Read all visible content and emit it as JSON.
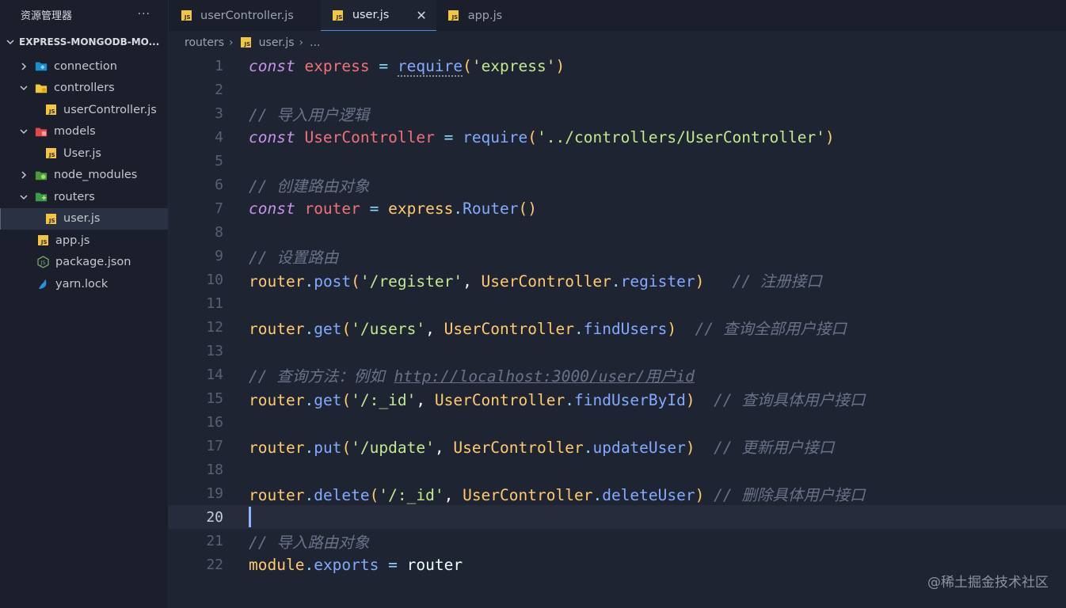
{
  "sidebar": {
    "title": "资源管理器",
    "more": "···",
    "project": "EXPRESS-MONGODB-MO...",
    "items": [
      {
        "label": "connection",
        "type": "folder",
        "expanded": false,
        "depth": 1
      },
      {
        "label": "controllers",
        "type": "folder",
        "expanded": true,
        "depth": 1
      },
      {
        "label": "userController.js",
        "type": "js",
        "depth": 2
      },
      {
        "label": "models",
        "type": "folder",
        "expanded": true,
        "depth": 1
      },
      {
        "label": "User.js",
        "type": "js",
        "depth": 2
      },
      {
        "label": "node_modules",
        "type": "folder",
        "expanded": false,
        "depth": 1
      },
      {
        "label": "routers",
        "type": "folder",
        "expanded": true,
        "depth": 1
      },
      {
        "label": "user.js",
        "type": "js",
        "depth": 2,
        "active": true
      },
      {
        "label": "app.js",
        "type": "js",
        "depth": 1
      },
      {
        "label": "package.json",
        "type": "json",
        "depth": 1
      },
      {
        "label": "yarn.lock",
        "type": "yarn",
        "depth": 1
      }
    ]
  },
  "tabs": [
    {
      "label": "userController.js",
      "active": false
    },
    {
      "label": "user.js",
      "active": true,
      "close": "✕"
    },
    {
      "label": "app.js",
      "active": false
    }
  ],
  "breadcrumb": {
    "folder": "routers",
    "file": "user.js",
    "more": "..."
  },
  "editor": {
    "current_line": 20,
    "lines": [
      {
        "n": "1"
      },
      {
        "n": "2"
      },
      {
        "n": "3"
      },
      {
        "n": "4"
      },
      {
        "n": "5"
      },
      {
        "n": "6"
      },
      {
        "n": "7"
      },
      {
        "n": "8"
      },
      {
        "n": "9"
      },
      {
        "n": "10"
      },
      {
        "n": "11"
      },
      {
        "n": "12"
      },
      {
        "n": "13"
      },
      {
        "n": "14"
      },
      {
        "n": "15"
      },
      {
        "n": "16"
      },
      {
        "n": "17"
      },
      {
        "n": "18"
      },
      {
        "n": "19"
      },
      {
        "n": "20"
      },
      {
        "n": "21"
      },
      {
        "n": "22"
      }
    ],
    "code": {
      "l1": {
        "kw": "const",
        "var": "express",
        "op": "=",
        "fn": "require",
        "str": "'express'"
      },
      "l3": {
        "comment": "// 导入用户逻辑"
      },
      "l4": {
        "kw": "const",
        "var": "UserController",
        "op": "=",
        "fn": "require",
        "str": "'../controllers/UserController'"
      },
      "l6": {
        "comment": "// 创建路由对象"
      },
      "l7": {
        "kw": "const",
        "var": "router",
        "op": "=",
        "obj": "express",
        "fn": "Router"
      },
      "l9": {
        "comment": "// 设置路由"
      },
      "l10": {
        "obj": "router",
        "fn": "post",
        "str": "'/register'",
        "arg": "UserController",
        "method": "register",
        "comment": "// 注册接口"
      },
      "l12": {
        "obj": "router",
        "fn": "get",
        "str": "'/users'",
        "arg": "UserController",
        "method": "findUsers",
        "comment": "// 查询全部用户接口"
      },
      "l14": {
        "comment": "// 查询方法：例如 ",
        "link": "http://localhost:3000/user/用户id"
      },
      "l15": {
        "obj": "router",
        "fn": "get",
        "str": "'/:_id'",
        "arg": "UserController",
        "method": "findUserById",
        "comment": "// 查询具体用户接口"
      },
      "l17": {
        "obj": "router",
        "fn": "put",
        "str": "'/update'",
        "arg": "UserController",
        "method": "updateUser",
        "comment": "// 更新用户接口"
      },
      "l19": {
        "obj": "router",
        "fn": "delete",
        "str": "'/:_id'",
        "arg": "UserController",
        "method": "deleteUser",
        "comment": "// 删除具体用户接口"
      },
      "l21": {
        "comment": "// 导入路由对象"
      },
      "l22": {
        "obj": "module",
        "fn": "exports",
        "op": "=",
        "var": "router"
      }
    }
  },
  "watermark": "@稀土掘金技术社区",
  "colors": {
    "background": "#1f2433",
    "sidebar": "#1b1f2b",
    "keyword": "#c792ea",
    "string": "#c3e88d",
    "function": "#82aaff",
    "variable": "#f07178",
    "comment": "#6a7288",
    "accent": "#4c8be0"
  }
}
